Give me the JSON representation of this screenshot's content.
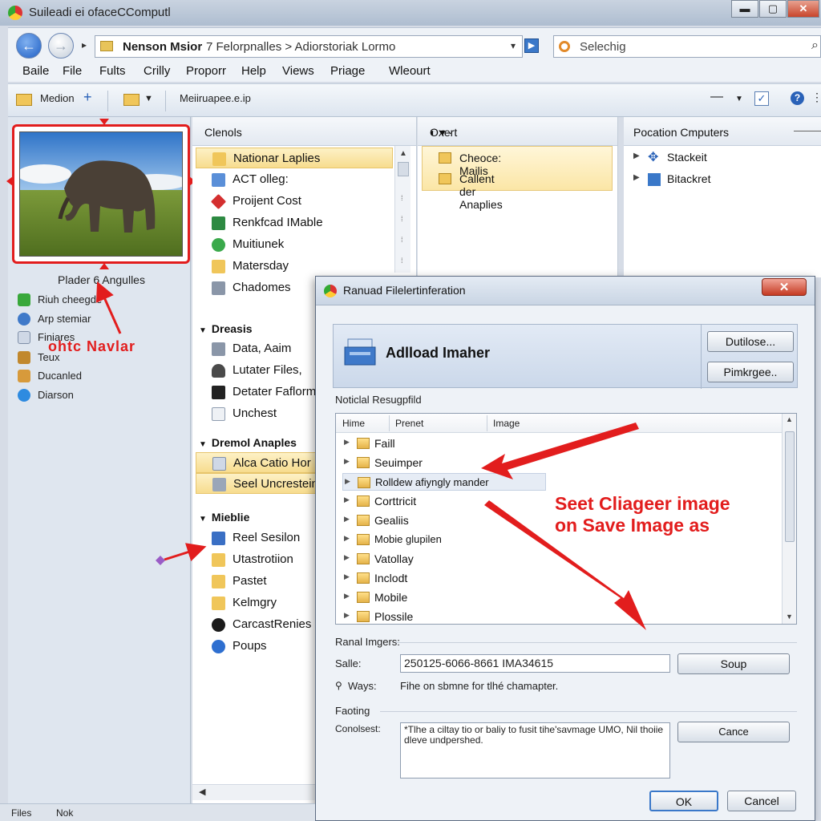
{
  "window": {
    "title": "Suileadi ei ofaceCComputl",
    "address_segment_1": "Nenson Msior",
    "address_segment_2": "7 Felorpnalles  >  Adiorstoriak Lormo",
    "search_placeholder": "Selechig"
  },
  "menu": [
    "Baile",
    "File",
    "Fults",
    "Crilly",
    "Proporr",
    "Help",
    "Views",
    "Priage",
    "Wleourt"
  ],
  "toolbar": {
    "item1": "Medion",
    "item3": "Meiiruapee.e.ip"
  },
  "left_pane": {
    "thumbnail_caption": "Plader 6 Angulles",
    "items": [
      {
        "label": "Riuh cheegde",
        "icon": "green-refresh-icon"
      },
      {
        "label": "Arp stemiar",
        "icon": "globe-icon"
      },
      {
        "label": "Finiares",
        "icon": "document-icon"
      },
      {
        "label": "Teux",
        "icon": "text-icon"
      },
      {
        "label": "Ducanled",
        "icon": "box-icon"
      },
      {
        "label": "Diarson",
        "icon": "blue-circle-icon"
      }
    ],
    "annotation": "ohtc Navlar"
  },
  "middle_pane": {
    "header": "Clenols",
    "items_1": [
      "Nationar Laplies",
      "ACT olleg:",
      "Proijent Cost",
      "Renkfcad IMable",
      "Muitiunek",
      "Matersday",
      "Chadomes"
    ],
    "section_2": "Dreasis",
    "items_2": [
      "Data, Aaim",
      "Lutater Files,",
      "Detater Faflorm",
      "Unchest"
    ],
    "section_3": "Dremol Anaples",
    "items_3": [
      "Alca Catio Hor",
      "Seel Uncrestein"
    ],
    "section_4": "Mieblie",
    "items_4": [
      "Reel Sesilon",
      "Utastrotiion",
      "Pastet",
      "Kelmgry",
      "CarcastRenies",
      "Poups"
    ]
  },
  "third_pane": {
    "header": "Oxert",
    "items": [
      "Cheoce: Mailis",
      "Callent der Anaplies"
    ]
  },
  "fourth_pane": {
    "header": "Pocation Cmputers",
    "items": [
      "Stackeit",
      "Bitackret"
    ]
  },
  "dialog": {
    "title": "Ranuad Filelertinferation",
    "heading": "Adlload Imaher",
    "btn_dutilose": "Dutilose...",
    "btn_pimkrgee": "Pimkrgee..",
    "list_label": "Noticlal Resugpfild",
    "columns": [
      "Hime",
      "Prenet",
      "Image"
    ],
    "list_items": [
      "Faill",
      "Seuimper",
      "Rolldew afiyngly mander",
      "Corttricit",
      "Gealiis",
      "Mobie glupilen",
      "Vatollay",
      "Inclodt",
      "Mobile",
      "Plossile"
    ],
    "annotation_line1": "Seet Cliageer image",
    "annotation_line2": "on Save Image as",
    "section_label": "Ranal Imgers:",
    "salle_label": "Salle:",
    "salle_value": "250125-6066-8661 IMA34615",
    "soup_btn": "Soup",
    "ways_label": "Ways:",
    "ways_text": "Fihe on sbmne for tlhé chamapter.",
    "footing_label": "Faoting",
    "conclest_label": "Conolsest:",
    "conclest_text": "*Tlhe a ciltay tio or baliy to fusit tihe'savmage UMO, Nil thoiie dleve undpershed.",
    "cance_btn": "Cance",
    "ok_btn": "OK",
    "cancel_btn": "Cancel"
  },
  "statusbar": {
    "left": "Files",
    "right": "Nok"
  },
  "colors": {
    "annotation_red": "#e21d1d",
    "selection_yellow": "#f7dc8e",
    "accent_blue": "#1f5fc4"
  }
}
